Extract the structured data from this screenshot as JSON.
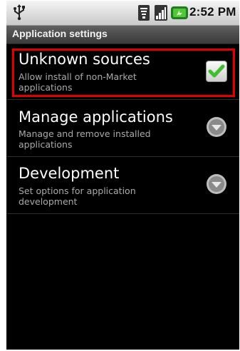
{
  "status_bar": {
    "time": "2:52 PM",
    "icons": [
      "usb-icon",
      "wifi-signal-icon",
      "cell-signal-icon",
      "battery-icon"
    ]
  },
  "header": {
    "title": "Application settings"
  },
  "settings": [
    {
      "title": "Unknown sources",
      "subtitle": "Allow install of non-Market applications",
      "control": "checkbox",
      "checked": true
    },
    {
      "title": "Manage applications",
      "subtitle": "Manage and remove installed applications",
      "control": "arrow"
    },
    {
      "title": "Development",
      "subtitle": "Set options for application development",
      "control": "arrow"
    }
  ],
  "colors": {
    "highlight": "#e10000",
    "check": "#3fbf2f",
    "background": "#000000"
  }
}
